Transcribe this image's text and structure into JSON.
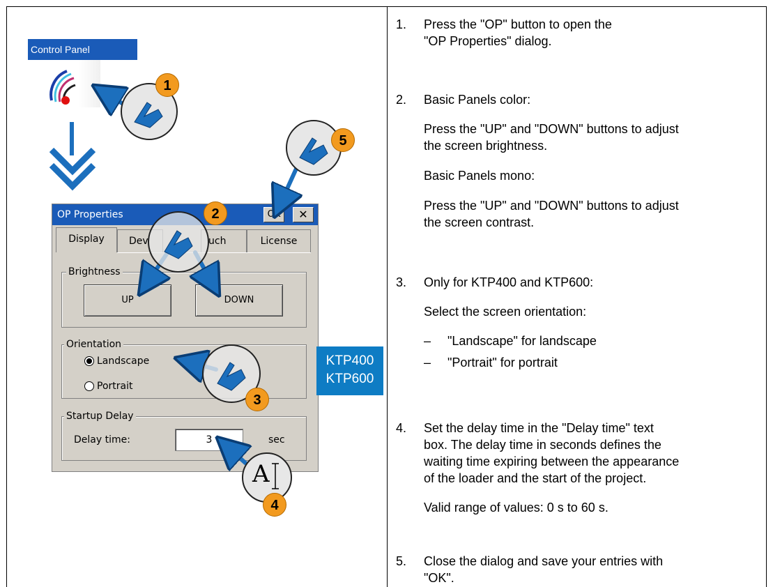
{
  "control_panel": {
    "title": "Control Panel",
    "icon": "control-panel-icon"
  },
  "dialog": {
    "title": "OP Properties",
    "ok_label": "OK",
    "close_glyph": "✕",
    "tabs": [
      "Display",
      "Dev",
      "uch",
      "License"
    ],
    "brightness": {
      "label": "Brightness",
      "up": "UP",
      "down": "DOWN"
    },
    "orientation": {
      "label": "Orientation",
      "landscape": "Landscape",
      "portrait": "Portrait",
      "selected": "Landscape"
    },
    "startup": {
      "label": "Startup Delay",
      "delay_label": "Delay time:",
      "delay_value": "3",
      "unit": "sec"
    }
  },
  "callouts": {
    "one": "1",
    "two": "2",
    "three": "3",
    "four": "4",
    "five": "5",
    "models": [
      "KTP400",
      "KTP600"
    ],
    "text_cursor": "A"
  },
  "steps": [
    {
      "num": "1.",
      "lines": [
        "Press the \"OP\" button to open the",
        "\"OP Properties\" dialog."
      ]
    },
    {
      "num": "2.",
      "title": "Basic Panels color:",
      "p1": [
        "Press the \"UP\" and \"DOWN\" buttons to adjust",
        "the screen brightness."
      ],
      "p2": "Basic Panels mono:",
      "p3": [
        "Press the \"UP\" and \"DOWN\" buttons to adjust",
        "the screen contrast."
      ]
    },
    {
      "num": "3.",
      "title": "Only for KTP400 and KTP600:",
      "p1": "Select the screen orientation:",
      "bullets": [
        {
          "dash": "–",
          "text": "\"Landscape\" for landscape"
        },
        {
          "dash": "–",
          "text": "\"Portrait\" for portrait"
        }
      ]
    },
    {
      "num": "4.",
      "lines": [
        "Set the delay time in the \"Delay time\" text",
        "box. The delay time in seconds defines the",
        "waiting time expiring between the appearance",
        "of the loader and the start of the project."
      ],
      "p2": "Valid range of values: 0 s to 60 s."
    },
    {
      "num": "5.",
      "lines": [
        "Close the dialog and save your entries with",
        "\"OK\"."
      ]
    }
  ],
  "colors": {
    "title_bar": "#1a5bb8",
    "callout_arrow": "#1c6fbd",
    "badge": "#f29a1f",
    "model_box": "#0e7cc4"
  }
}
